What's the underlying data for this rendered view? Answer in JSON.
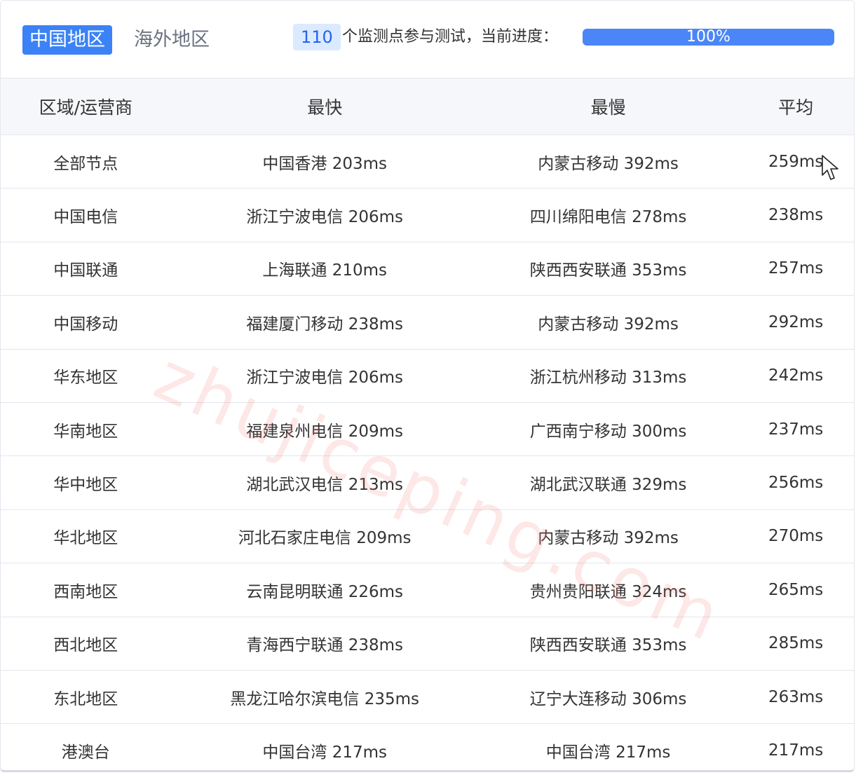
{
  "tabs": {
    "china": "中国地区",
    "overseas": "海外地区"
  },
  "progress": {
    "node_count": "110",
    "label": "个监测点参与测试，当前进度：",
    "percent_text": "100%",
    "percent_value": 100
  },
  "table": {
    "headers": [
      "区域/运营商",
      "最快",
      "最慢",
      "平均"
    ],
    "rows": [
      [
        "全部节点",
        "中国香港 203ms",
        "内蒙古移动 392ms",
        "259ms"
      ],
      [
        "中国电信",
        "浙江宁波电信 206ms",
        "四川绵阳电信 278ms",
        "238ms"
      ],
      [
        "中国联通",
        "上海联通 210ms",
        "陕西西安联通 353ms",
        "257ms"
      ],
      [
        "中国移动",
        "福建厦门移动 238ms",
        "内蒙古移动 392ms",
        "292ms"
      ],
      [
        "华东地区",
        "浙江宁波电信 206ms",
        "浙江杭州移动 313ms",
        "242ms"
      ],
      [
        "华南地区",
        "福建泉州电信 209ms",
        "广西南宁移动 300ms",
        "237ms"
      ],
      [
        "华中地区",
        "湖北武汉电信 213ms",
        "湖北武汉联通 329ms",
        "256ms"
      ],
      [
        "华北地区",
        "河北石家庄电信 209ms",
        "内蒙古移动 392ms",
        "270ms"
      ],
      [
        "西南地区",
        "云南昆明联通 226ms",
        "贵州贵阳联通 324ms",
        "265ms"
      ],
      [
        "西北地区",
        "青海西宁联通 238ms",
        "陕西西安联通 353ms",
        "285ms"
      ],
      [
        "东北地区",
        "黑龙江哈尔滨电信 235ms",
        "辽宁大连移动 306ms",
        "263ms"
      ],
      [
        "港澳台",
        "中国台湾 217ms",
        "中国台湾 217ms",
        "217ms"
      ]
    ]
  },
  "watermark": "zhujiceping.com",
  "colors": {
    "accent": "#3b82f6",
    "badge_bg": "#dbeafe",
    "header_bg": "#f5f7fa"
  },
  "icons": {
    "cursor": "mouse-pointer-icon"
  }
}
